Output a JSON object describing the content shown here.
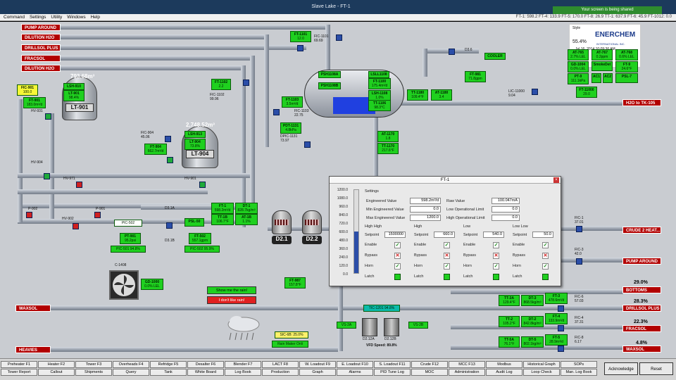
{
  "window": {
    "title": "Slave Lake - FT-1",
    "share_banner": "Your screen is being shared"
  },
  "menu": [
    "Command",
    "Settings",
    "Utility",
    "Windows",
    "Help"
  ],
  "readout": "FT-1: 598.2  FT-4: 133.9  FT-5: 170.0  FT-8: 26.9  TT-1: 637.9  FT-6: 45.9  FT-1012: 0.0",
  "sources": [
    "PUMP AROUND",
    "DILUTION H2O",
    "DRILLSOL PLUS",
    "FRACSOL",
    "DILUTION H2O"
  ],
  "destinations": {
    "h2o": "H2O to TK-105",
    "crude": "CRUDE 2 HEAT...",
    "pump_around": "PUMP AROUND",
    "bottoms": "BOTTOMS",
    "bottoms_pct": "29.0%",
    "drillsol": "DRILLSOL PLUS",
    "drillsol_pct": "28.3%",
    "fracsol": "FRACSOL",
    "fracsol_pct": "22.3%",
    "waxsol": "WAXSOL",
    "waxsol_pct": "4.8%",
    "waxsol_in": "WAXSOL",
    "heavies": "HEAVIES"
  },
  "logo": {
    "style": "Style",
    "pct": "55.4%",
    "brand": "ENERCHEM",
    "sub": "INTERNATIONAL INC.",
    "date": "Jul 16, 2014 10:09:36 AM"
  },
  "tanks": {
    "lt901": {
      "id": "LT-901",
      "level": "793.68m³"
    },
    "lt904": {
      "id": "LT-904",
      "level": "2,748.52m³"
    }
  },
  "exchangers": {
    "d21": "D2.1",
    "d22": "D2.2"
  },
  "tags": {
    "fic901": [
      "FIC-901",
      "100.0"
    ],
    "ft901": [
      "FT-901",
      "183.0m³/d"
    ],
    "lsh910": [
      "LSH-910"
    ],
    "lt901t": [
      "LT-901",
      "98.4%"
    ],
    "lsh913": [
      "LSH-913"
    ],
    "lt904t": [
      "LT-904",
      "73.8%"
    ],
    "ft904": [
      "FT-904",
      "662.7m³/d"
    ],
    "ft1101": [
      "FT-1101",
      "12.0"
    ],
    "ft1102": [
      "FT-1102",
      "2.2"
    ],
    "ft1103": [
      "FT-1103",
      "3.5m³/d"
    ],
    "pdt1131": [
      "PDT-1131",
      "4.8kPa"
    ],
    "psh": [
      "PSH1108A"
    ],
    "psh2": [
      "PSH1108B"
    ],
    "lsl": [
      "LSLL1108"
    ],
    "lsh": [
      "LSH-1108",
      "1.0%"
    ],
    "ft1100": [
      "FT-1100",
      "175.4m³/d"
    ],
    "tt1106": [
      "TT-1106",
      "98.3°C"
    ],
    "at1170": [
      "AT-1170",
      "1.8"
    ],
    "tt1170": [
      "TT-1170",
      "217.6°F"
    ],
    "tt1180": [
      "TT-1180",
      "109.4°F"
    ],
    "at1180": [
      "AT-1180",
      "3.4"
    ],
    "ft981": [
      "FT-981",
      "71.8gpm"
    ],
    "at765": [
      "AT-765",
      "2.7% LEL"
    ],
    "at767": [
      "AT-767",
      "0.2ppm"
    ],
    "at768": [
      "AT-768",
      "0.6% LEL"
    ],
    "gd1004": [
      "GD-1004",
      "0.0% LEL"
    ],
    "smoke": [
      "SmokeDet"
    ],
    "ft9": [
      "FT-9",
      "24.6°F"
    ],
    "pt9": [
      "PT-9",
      "111.1kPa"
    ],
    "ac1": [
      "AC1"
    ],
    "ac2": [
      "AC2"
    ],
    "psl7": [
      "PSL-7"
    ],
    "ft11000": [
      "FT-11000",
      "29.0"
    ],
    "ft1": [
      "FT-1",
      "598.2m³/d"
    ],
    "dt1": [
      "DT-1",
      "828.7kg/m³"
    ],
    "tt1b": [
      "TT-1B",
      "106.7°F"
    ],
    "at1b": [
      "AT-1B",
      "1.1%"
    ],
    "psl50": [
      "PSL-50"
    ],
    "ft502": [
      "FT-502",
      "557.1gpm"
    ],
    "pt901": [
      "PT-901",
      "95.2psi"
    ],
    "gd1000": [
      "GD-1000",
      "0.0% LEL"
    ],
    "ft987": [
      "FT-987",
      "157.8°F"
    ],
    "tt3a": [
      "TT-3A",
      "129.4°F"
    ],
    "dt3": [
      "DT-3",
      "868.5kg/m³"
    ],
    "ft3": [
      "FT-3",
      "478.6m³/d"
    ],
    "tt2": [
      "TT-2",
      "105.2°F"
    ],
    "dt2": [
      "DT-2",
      "842.8kg/m³"
    ],
    "ft4": [
      "FT-4",
      "133.9m³/d"
    ],
    "tt5a": [
      "TT-5A",
      "76.1°F"
    ],
    "dt5": [
      "DT-5",
      "802.1kg/m³"
    ],
    "ft5": [
      "FT-5",
      "28.9m³/d"
    ]
  },
  "pic_bars": {
    "pic501": "PIC-501 94.8%",
    "pic502": "PIC-502 95.9%",
    "tic1201": "TIC-1201 94.8%",
    "sic6b": "SIC-6B: 25.0%"
  },
  "labels": {
    "fic1101": "FIC-1101\n69.69",
    "fic1102": "FIC-1102\n99.96",
    "fic1103": "FIC-1103\n22.75",
    "dpic1131": "DPIC-1131\n73.97",
    "fic904": "FIC-904\n45.06",
    "lic11000": "LIC-11000\n9.04",
    "d36": "D3.6",
    "cooler": "COOLER",
    "hv931": "HV-931",
    "hv904": "HV-904",
    "hv971": "HV-971",
    "hv901": "HV-901",
    "hv902": "HV-902",
    "p902": "P-902",
    "p901": "P-901",
    "pic502": "PIC-502",
    "d31a": "D3.1A",
    "d31b": "D3.1B",
    "c1408": "C-1408",
    "fic1": "FIC-1\n37.01",
    "fic3": "FIC-3\n42.0",
    "fic6": "FIC-6\n57.03",
    "fic4": "FIC-4\n37.31",
    "fic8": "FIC-8\n6.17",
    "vs2a": "VS-2A",
    "vs2b": "VS-2B",
    "d212a": "D2.12A",
    "d212b": "D2.12B",
    "vfd": "VFD Speed: 89.8%",
    "rain_maker": "Rain Maker Onli"
  },
  "buttons": {
    "show_rain": "Show me the rain!",
    "dont_like": "I don't like rain!",
    "acknowledge": "Acknowledge",
    "reset": "Reset"
  },
  "dialog": {
    "title": "FT-1",
    "settings": "Settings",
    "eng_value_lbl": "Engineered Value",
    "eng_value": "598.2m³/d",
    "raw_value_lbl": "Raw Value",
    "raw_value": "100.047mA",
    "min_eng_lbl": "Min Engineered Value",
    "min_eng": "0.0",
    "low_op_lbl": "Low Operational Limit",
    "low_op": "0.0",
    "max_eng_lbl": "Max Engineered Value",
    "max_eng": "1200.0",
    "high_op_lbl": "High Operational Limit",
    "high_op": "0.0",
    "groups": [
      {
        "name": "High High",
        "setpoint": "1500000"
      },
      {
        "name": "High",
        "setpoint": "660.0"
      },
      {
        "name": "Low",
        "setpoint": "540.0"
      },
      {
        "name": "Low Low",
        "setpoint": "50.0"
      }
    ],
    "setpoint_lbl": "Setpoint",
    "rows": [
      "Enable",
      "Bypass",
      "Horn",
      "Latch"
    ],
    "scale": [
      "1200.0",
      "1080.0",
      "960.0",
      "840.0",
      "720.0",
      "600.0",
      "480.0",
      "360.0",
      "240.0",
      "120.0",
      "0.0"
    ],
    "fill_fraction": 0.4985
  },
  "tabs_row1": [
    "Preheater F1",
    "Heater F2",
    "Tower F3",
    "Overheads F4",
    "Refridge F5",
    "Desalter F6",
    "Blender F7",
    "LACT F8",
    "W. Loadout F9",
    "E. Loadout F10",
    "S. Loadout F11",
    "Crude F12",
    "MCC F13",
    "Modbus",
    "Historical Graph",
    "SOPs"
  ],
  "tabs_row2": [
    "Tower Report",
    "Callout",
    "Shipments",
    "Query",
    "Tank",
    "White Board",
    "Log Book",
    "Production",
    "Graph",
    "Alarms",
    "PID Tune Log",
    "MOC",
    "Administration",
    "Audit Log",
    "Loop Check",
    "Man. Log Book"
  ]
}
